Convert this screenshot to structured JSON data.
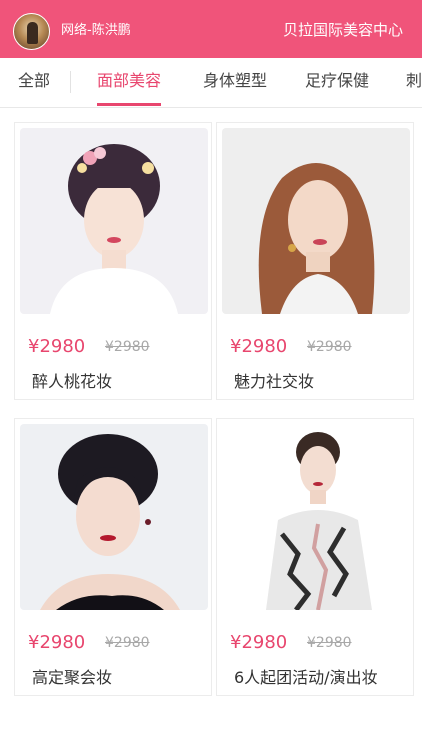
{
  "header": {
    "user_name": "网络-陈洪鹏",
    "shop_name": "贝拉国际美容中心"
  },
  "tabs": [
    {
      "label": "全部"
    },
    {
      "label": "面部美容"
    },
    {
      "label": "身体塑型"
    },
    {
      "label": "足疗保健"
    },
    {
      "label": "刺"
    }
  ],
  "active_tab": 1,
  "products": [
    {
      "price": "¥2980",
      "original_price": "¥2980",
      "name": "醉人桃花妆"
    },
    {
      "price": "¥2980",
      "original_price": "¥2980",
      "name": "魅力社交妆"
    },
    {
      "price": "¥2980",
      "original_price": "¥2980",
      "name": "高定聚会妆"
    },
    {
      "price": "¥2980",
      "original_price": "¥2980",
      "name": "6人起团活动/演出妆"
    }
  ],
  "colors": {
    "header_bg": "#f0547a",
    "accent": "#e8466e",
    "strikethrough": "#a8a8a8"
  }
}
